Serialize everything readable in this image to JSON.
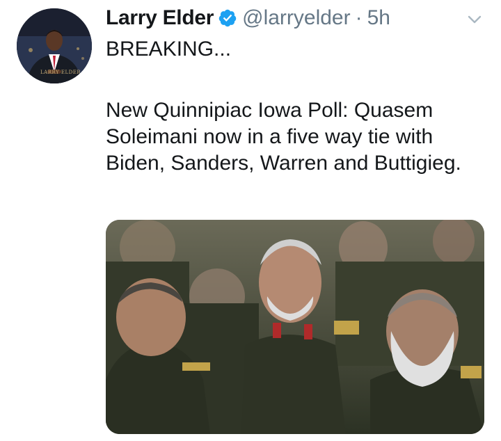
{
  "author": {
    "display_name": "Larry Elder",
    "handle": "@larryelder",
    "separator": "·",
    "time": "5h",
    "avatar_watermark": "LARRY ELDER"
  },
  "tweet": {
    "line1": "BREAKING...",
    "line2": "New Quinnipiac Iowa Poll: Quasem Soleimani now in a five way tie with Biden, Sanders, Warren and Buttigieg."
  },
  "icons": {
    "verified": "verified-badge-icon",
    "caret": "chevron-down-icon"
  },
  "colors": {
    "verified_blue": "#1da1f2",
    "secondary_text": "#657786",
    "primary_text": "#14171a"
  }
}
